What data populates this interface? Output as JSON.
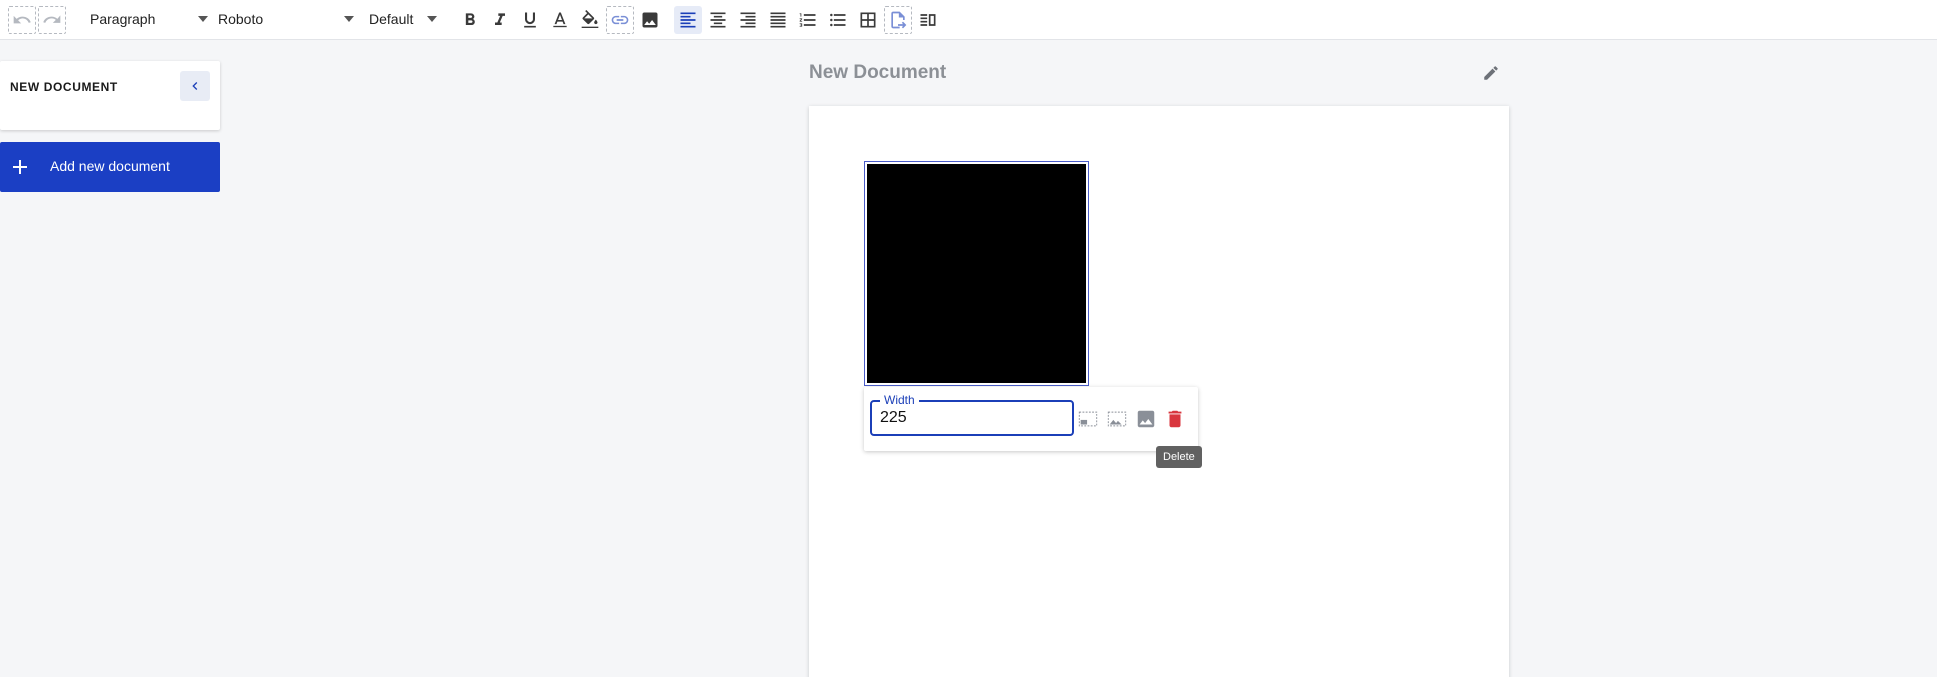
{
  "toolbar": {
    "block_format": "Paragraph",
    "font_family": "Roboto",
    "font_size": "Default",
    "buttons": [
      {
        "name": "undo-icon"
      },
      {
        "name": "redo-icon"
      },
      {
        "name": "bold-icon"
      },
      {
        "name": "italic-icon"
      },
      {
        "name": "underline-icon"
      },
      {
        "name": "text-color-icon"
      },
      {
        "name": "highlight-icon"
      },
      {
        "name": "link-icon"
      },
      {
        "name": "image-icon"
      },
      {
        "name": "align-left-icon"
      },
      {
        "name": "align-center-icon"
      },
      {
        "name": "align-right-icon"
      },
      {
        "name": "align-justify-icon"
      },
      {
        "name": "numbered-list-icon"
      },
      {
        "name": "bulleted-list-icon"
      },
      {
        "name": "table-icon"
      },
      {
        "name": "page-break-icon"
      },
      {
        "name": "columns-icon"
      }
    ],
    "active_alignment": "left",
    "accent_color": "#1b3fb8"
  },
  "sidebar": {
    "document_title": "NEW DOCUMENT",
    "add_button_label": "Add new document"
  },
  "document": {
    "title": "New Document"
  },
  "image_toolbar": {
    "width_label": "Width",
    "width_value": "225",
    "tooltip": "Delete"
  }
}
